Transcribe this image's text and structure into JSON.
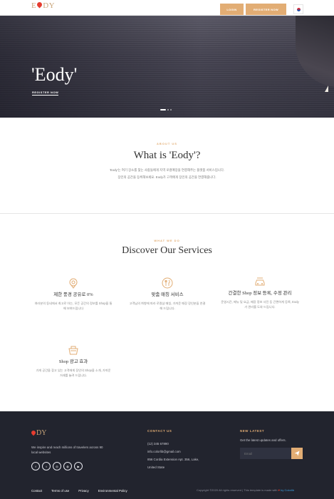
{
  "header": {
    "logo": {
      "before": "E",
      "after": "DY"
    },
    "login_label": "LOGIN",
    "register_label": "REGISTER NOW"
  },
  "hero": {
    "title": "'Eody'",
    "cta_label": "REGISTER NOW",
    "slide_dots": 3,
    "active_slide": 1
  },
  "about": {
    "eyebrow": "ABOUT US",
    "title": "What is 'Eody'?",
    "line1": "'Eody'는 여기 장소를 찾는 사람들에게 지역 로컬매장을 연결해주는 플랫폼 서비스입니다.",
    "line2": "장인의 공간을 등록해보세요. Eody가 고객에게 장인의 공간을 연결해줍니다."
  },
  "services": {
    "eyebrow": "WHAT WE DO",
    "title": "Discover Our Services",
    "items": [
      {
        "icon": "map-pin-icon",
        "title": "제한 풍경 공유로 0%",
        "desc": "여러분의 동네에서 최고로 아는, 모든 공간의 정보를 Shop을 통해 보여드립니다"
      },
      {
        "icon": "restaurant-icon",
        "title": "맞춤 매칭 서비스",
        "desc": "고객님의 취향에 따라 로컬샵 매칭, 가까운 매장 장인분들 연결해 드립니다."
      },
      {
        "icon": "car-icon",
        "title": "간결한 Shop 정보 등록, 수정 관리",
        "desc": "운영시간, 메뉴 및 요금, 매장 정보 사진 등 간편하게 등록, Eody가 관리를 도와 드립니다."
      },
      {
        "icon": "basket-icon",
        "title": "Shop 광고 효과",
        "desc": "가게 공간을 찾고 있는 고객에게 장인의 Shop을 소개, 가까운 거래를 늘려 드립니다."
      }
    ]
  },
  "footer": {
    "logo": {
      "before": "",
      "after": "DY"
    },
    "tagline": "We inspire and reach millions of travelers across 90 local websites",
    "socials": [
      "facebook-icon",
      "twitter-icon",
      "instagram-icon",
      "dribbble-icon",
      "youtube-icon"
    ],
    "contact_heading": "CONTACT US",
    "phone": "(12) 345 67890",
    "email": "info.colorlib@gmail.com",
    "address_line1": "856 Cordia Extension Apt. 356, Lake,",
    "address_line2": "United State",
    "news_heading": "NEW LATEST",
    "news_text": "Get the latest updates and offers.",
    "email_placeholder": "Email",
    "links": [
      "Contact",
      "Terms of use",
      "Privacy",
      "Environmental Policy"
    ],
    "copyright": "Copyright ©2020 All rights reserved | This template is made with",
    "credit": "by Colorlib"
  },
  "colors": {
    "accent": "#e2ad74",
    "footer_bg": "#22242e",
    "pin": "#e63c2f"
  }
}
